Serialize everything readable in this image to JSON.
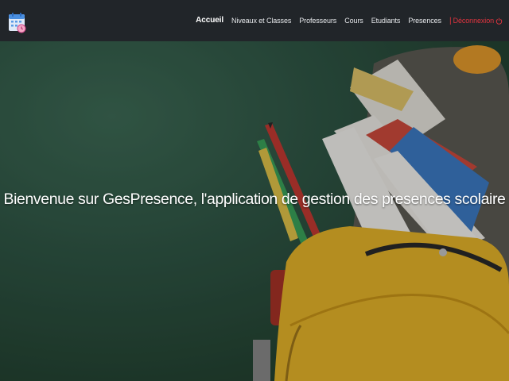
{
  "navbar": {
    "logo_icon": "calendar-clock-icon",
    "items": [
      {
        "label": "Accueil",
        "active": true
      },
      {
        "label": "Niveaux et Classes"
      },
      {
        "label": "Professeurs"
      },
      {
        "label": "Cours"
      },
      {
        "label": "Etudiants"
      },
      {
        "label": "Presences"
      }
    ],
    "separator": "|",
    "logout_label": "Déconnexion",
    "logout_icon": "power-icon"
  },
  "hero": {
    "welcome_text": "Bienvenue sur GesPresence, l'application de gestion des presences scolaire"
  },
  "colors": {
    "navbar_bg": "#212529",
    "logout": "#e0343f",
    "chalkboard": "#2f5645",
    "backpack": "#e7b52a"
  }
}
